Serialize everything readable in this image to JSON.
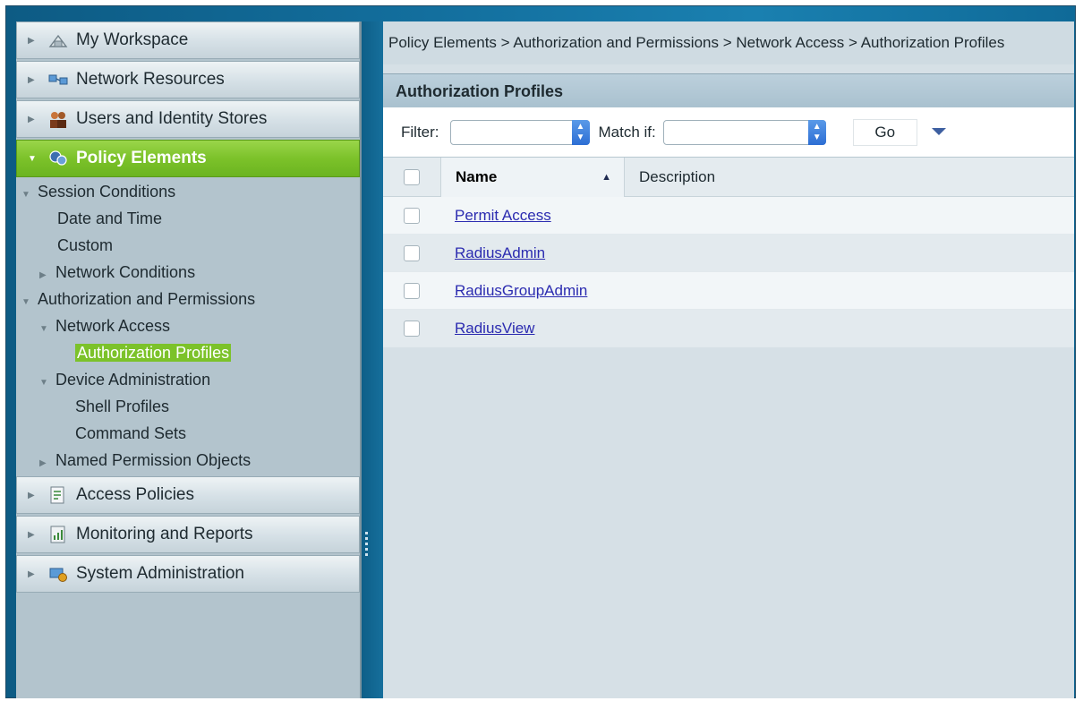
{
  "sidebar": {
    "drawers_top": [
      {
        "label": "My Workspace",
        "icon": "workspace-icon"
      },
      {
        "label": "Network Resources",
        "icon": "network-resources-icon"
      },
      {
        "label": "Users and Identity Stores",
        "icon": "users-icon"
      }
    ],
    "active_drawer": {
      "label": "Policy Elements",
      "icon": "policy-elements-icon"
    },
    "tree": {
      "session_conditions": "Session Conditions",
      "date_and_time": "Date and Time",
      "custom": "Custom",
      "network_conditions": "Network Conditions",
      "authorization_and_permissions": "Authorization and Permissions",
      "network_access": "Network Access",
      "authorization_profiles": "Authorization Profiles",
      "device_administration": "Device Administration",
      "shell_profiles": "Shell Profiles",
      "command_sets": "Command Sets",
      "named_permission_objects": "Named Permission Objects"
    },
    "drawers_bottom": [
      {
        "label": "Access Policies",
        "icon": "access-policies-icon"
      },
      {
        "label": "Monitoring and Reports",
        "icon": "monitoring-reports-icon"
      },
      {
        "label": "System Administration",
        "icon": "system-admin-icon"
      }
    ]
  },
  "main": {
    "breadcrumb": "Policy Elements > Authorization and Permissions > Network Access > Authorization Profiles",
    "panel_title": "Authorization Profiles",
    "toolbar": {
      "filter_label": "Filter:",
      "filter_value": "",
      "match_label": "Match if:",
      "match_value": "",
      "go_label": "Go"
    },
    "table": {
      "columns": [
        "Name",
        "Description"
      ],
      "rows": [
        {
          "name": "Permit Access",
          "description": ""
        },
        {
          "name": "RadiusAdmin",
          "description": ""
        },
        {
          "name": "RadiusGroupAdmin",
          "description": ""
        },
        {
          "name": "RadiusView",
          "description": ""
        }
      ]
    }
  },
  "colors": {
    "active_green": "#7cc22a",
    "link": "#2b2bb0",
    "frame_blue": "#136f9e"
  }
}
